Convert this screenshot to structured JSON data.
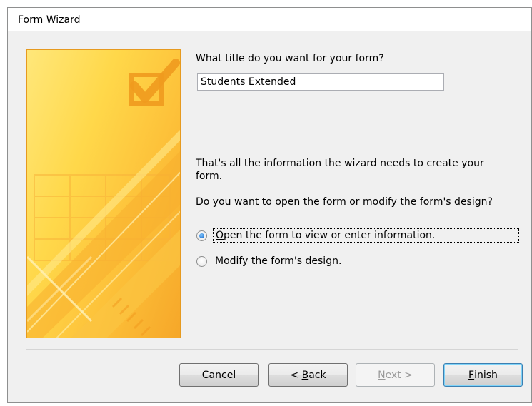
{
  "window": {
    "title": "Form Wizard"
  },
  "form_title_prompt": "What title do you want for your form?",
  "form_title_value": "Students Extended",
  "info_text": "That's all the information the wizard needs to create your form.",
  "open_modify_question": "Do you want to open the form or modify the form's design?",
  "options": {
    "open": {
      "mnemonic": "O",
      "rest": "pen the form to view or enter information.",
      "selected": true
    },
    "modify": {
      "mnemonic": "M",
      "rest": "odify the form's design.",
      "selected": false
    }
  },
  "buttons": {
    "cancel": "Cancel",
    "back_prefix": "< ",
    "back_mnemonic": "B",
    "back_rest": "ack",
    "next_mnemonic": "N",
    "next_rest": "ext >",
    "finish_mnemonic": "F",
    "finish_rest": "inish"
  },
  "icons": {
    "wizard_art": "form-checkmark-art",
    "radio": "radio-button"
  },
  "colors": {
    "art_border": "#e69a1f",
    "art_yellow": "#ffd84a",
    "art_orange": "#f6a729",
    "radio_dot": "#2a7bd6"
  }
}
